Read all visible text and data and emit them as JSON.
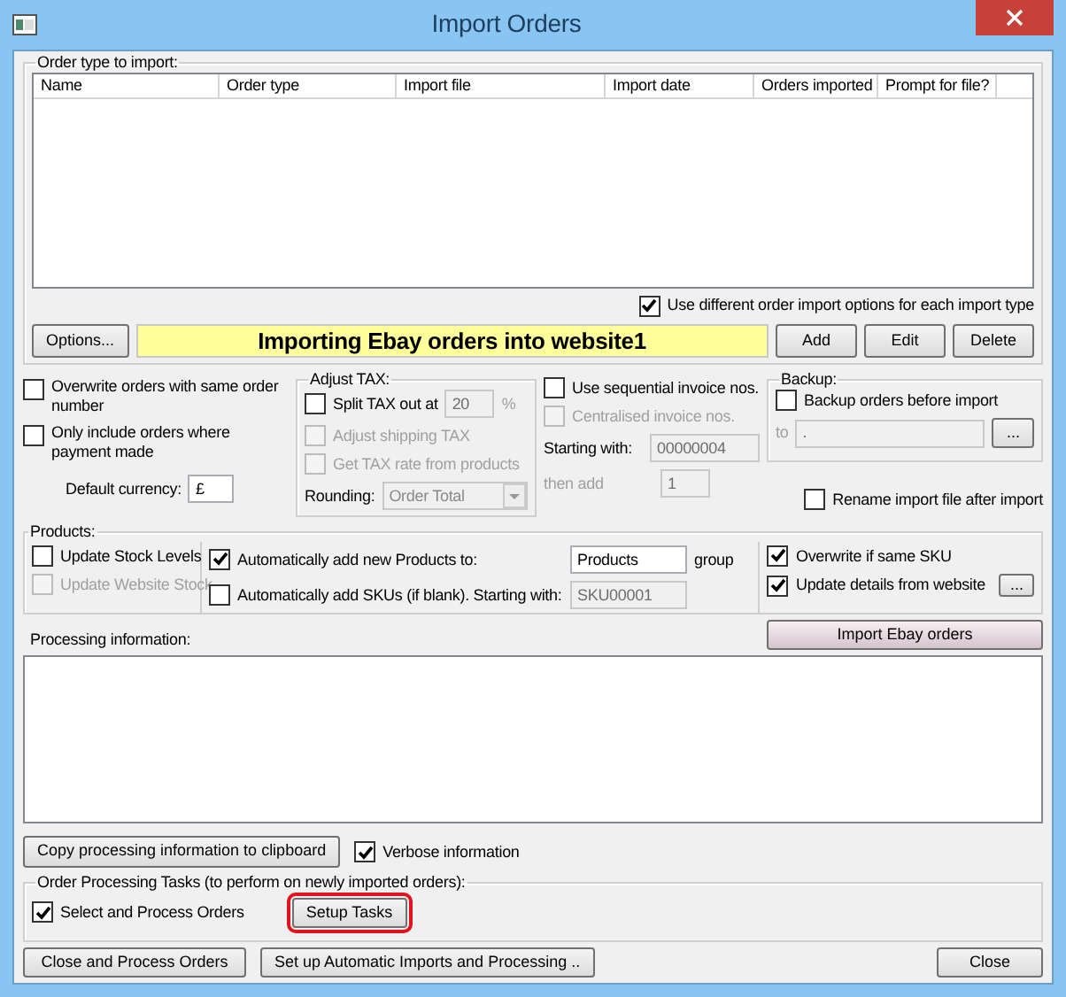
{
  "window": {
    "title": "Import Orders"
  },
  "order_types": {
    "label": "Order type to import:",
    "columns": [
      "Name",
      "Order type",
      "Import file",
      "Import date",
      "Orders imported",
      "Prompt for file?"
    ],
    "use_different_options": {
      "label": "Use different order import options for each import type",
      "checked": true
    },
    "options_button": "Options...",
    "banner": "Importing Ebay orders into website1",
    "buttons": [
      "Add",
      "Edit",
      "Delete"
    ]
  },
  "import_options": {
    "checkboxes": [
      {
        "label": "Overwrite orders with same order number",
        "checked": false
      },
      {
        "label": "Only include orders where payment made",
        "checked": false
      }
    ],
    "default_currency": {
      "label": "Default currency:",
      "value": "£"
    }
  },
  "adjust_tax": {
    "label": "Adjust TAX:",
    "split": {
      "label": "Split TAX out at",
      "checked": false,
      "disabled": false
    },
    "rate": {
      "value": "20",
      "disabled": true
    },
    "rate_unit": "%",
    "options": [
      {
        "label": "Adjust shipping TAX",
        "checked": false,
        "disabled": true
      },
      {
        "label": "Get TAX rate from products",
        "checked": false,
        "disabled": true
      }
    ],
    "rounding": {
      "label": "Rounding:",
      "value": "Order Total",
      "disabled": true
    }
  },
  "invoice_numbers": {
    "options": [
      {
        "label": "Use sequential invoice nos.",
        "checked": false,
        "disabled": false
      },
      {
        "label": "Centralised invoice nos.",
        "checked": false,
        "disabled": true
      }
    ],
    "starting_with": {
      "label": "Starting with:",
      "value": "00000004",
      "disabled": true
    },
    "then_add": {
      "label": "then add",
      "value": "1",
      "disabled": true
    }
  },
  "backup": {
    "label": "Backup:",
    "option": {
      "label": "Backup orders before import",
      "checked": false
    },
    "to_label": "to",
    "path": {
      "value": ".",
      "disabled": true
    },
    "browse_button": "..."
  },
  "rename_file": {
    "label": "Rename import file after import",
    "checked": false
  },
  "products": {
    "label": "Products:",
    "stock": [
      {
        "label": "Update Stock Levels",
        "checked": false,
        "disabled": false
      },
      {
        "label": "Update Website Stock",
        "checked": false,
        "disabled": true
      }
    ],
    "add_products": {
      "label": "Automatically add new Products to:",
      "checked": true,
      "group": {
        "value": "Products",
        "disabled": false
      },
      "suffix": "group"
    },
    "add_skus": {
      "label": "Automatically add SKUs (if blank). Starting with:",
      "checked": false,
      "start": {
        "value": "SKU00001",
        "disabled": true
      }
    },
    "sku_options": [
      {
        "label": "Overwrite if same SKU",
        "checked": true
      },
      {
        "label": "Update details from website",
        "checked": true
      }
    ],
    "details_button": "..."
  },
  "processing": {
    "label": "Processing information:",
    "import_button": "Import Ebay orders",
    "copy_button": "Copy processing information to clipboard",
    "verbose": {
      "label": "Verbose information",
      "checked": true
    }
  },
  "tasks": {
    "label": "Order Processing Tasks (to perform on newly imported orders):",
    "select_process": {
      "label": "Select and Process Orders",
      "checked": true
    },
    "setup_button": {
      "label": "Setup Tasks",
      "highlighted": true
    }
  },
  "footer": {
    "close_process_button": "Close and Process Orders",
    "automatic_button": "Set up Automatic Imports and Processing ..",
    "close_button": "Close"
  }
}
